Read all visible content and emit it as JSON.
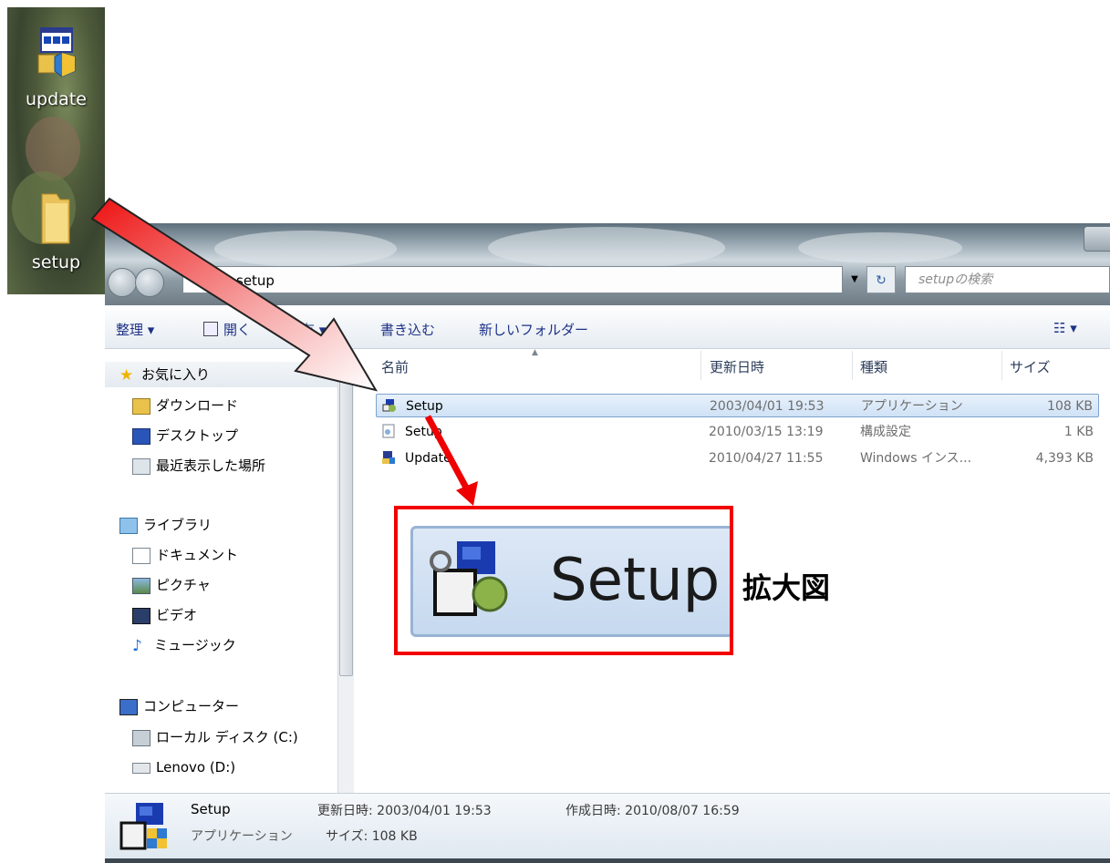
{
  "desktop": {
    "icons": [
      {
        "label": "update",
        "icon": "installer-icon"
      },
      {
        "label": "setup",
        "icon": "folder-icon"
      }
    ]
  },
  "window": {
    "address_path": "setup",
    "search_placeholder": "setupの検索"
  },
  "toolbar": {
    "organize": "整理 ▾",
    "open": "開く",
    "share": "共有 ▾",
    "burn": "書き込む",
    "new_folder": "新しいフォルダー",
    "view": "☷ ▾"
  },
  "nav": {
    "favorites": "お気に入り",
    "favorite_items": [
      "ダウンロード",
      "デスクトップ",
      "最近表示した場所"
    ],
    "libraries": "ライブラリ",
    "library_items": [
      "ドキュメント",
      "ピクチャ",
      "ビデオ",
      "ミュージック"
    ],
    "computer": "コンピューター",
    "computer_items": [
      "ローカル ディスク (C:)",
      "Lenovo (D:)"
    ]
  },
  "columns": {
    "name": "名前",
    "modified": "更新日時",
    "type": "種類",
    "size": "サイズ"
  },
  "files": [
    {
      "name": "Setup",
      "modified": "2003/04/01 19:53",
      "type": "アプリケーション",
      "size": "108 KB",
      "icon": "setup-app-icon",
      "selected": true
    },
    {
      "name": "Setup",
      "modified": "2010/03/15 13:19",
      "type": "構成設定",
      "size": "1 KB",
      "icon": "config-file-icon",
      "selected": false
    },
    {
      "name": "Update",
      "modified": "2010/04/27 11:55",
      "type": "Windows インス...",
      "size": "4,393 KB",
      "icon": "installer-icon",
      "selected": false
    }
  ],
  "status": {
    "name": "Setup",
    "modified_label": "更新日時: 2003/04/01 19:53",
    "created_label": "作成日時: 2010/08/07 16:59",
    "type": "アプリケーション",
    "size_label": "サイズ: 108 KB"
  },
  "callout": {
    "zoom_text": "Setup",
    "zoom_caption": "拡大図",
    "accent_color": "#f20000"
  }
}
